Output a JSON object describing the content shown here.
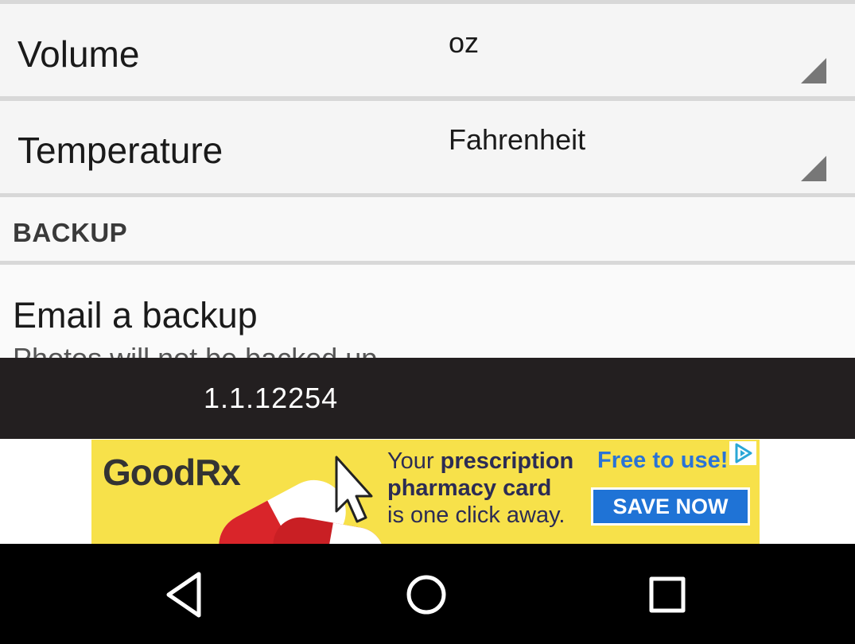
{
  "settings": {
    "volume": {
      "label": "Volume",
      "value": "oz"
    },
    "temperature": {
      "label": "Temperature",
      "value": "Fahrenheit"
    },
    "backup_section": {
      "header": "BACKUP"
    },
    "email_backup": {
      "label": "Email a backup",
      "subtitle": "Photos will not be backed up"
    }
  },
  "version": {
    "text": "1.1.12254"
  },
  "ad": {
    "brand": "GoodRx",
    "line1_prefix": "Your ",
    "line1_bold": "prescription",
    "line2": "pharmacy card",
    "line3": "is one click away.",
    "tagline": "Free to use!",
    "cta": "SAVE NOW",
    "brand_color": "#2a73d6",
    "background_color": "#f7e14a"
  },
  "navbar": {
    "back": "back-icon",
    "home": "home-icon",
    "recents": "recents-icon"
  },
  "colors": {
    "row_background": "#f5f5f5",
    "divider": "#d8d8d8",
    "version_bar": "#231f20",
    "navbar": "#000000"
  }
}
